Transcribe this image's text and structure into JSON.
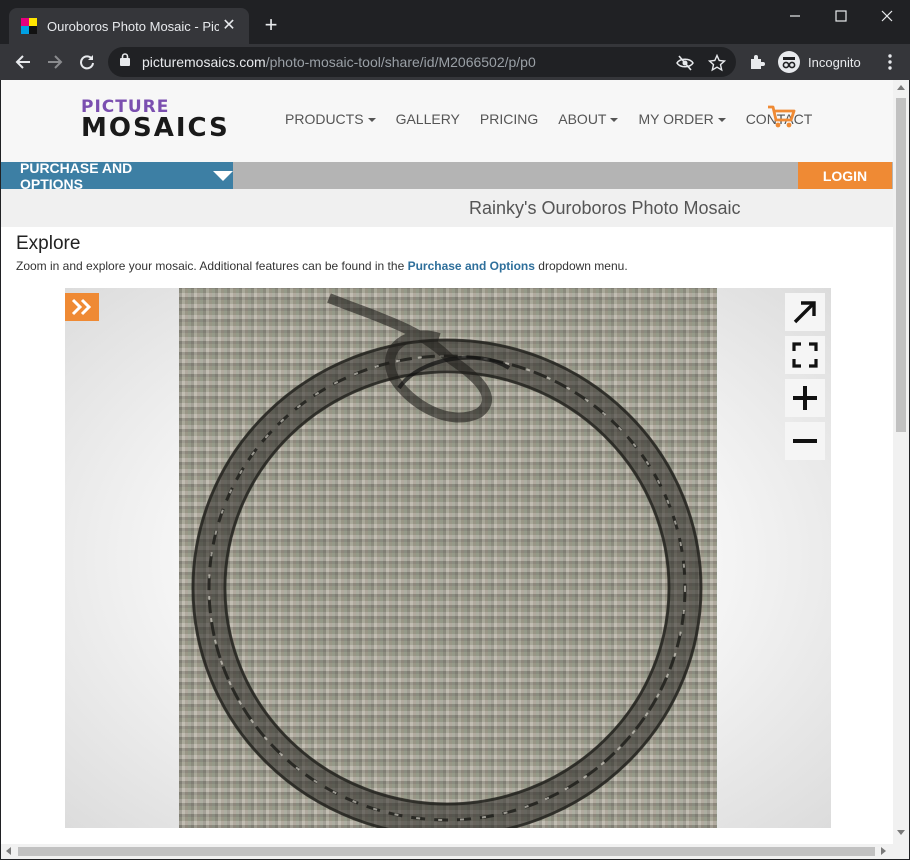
{
  "browser": {
    "tab_title": "Ouroboros Photo Mosaic - Picture Mosaics",
    "url_host": "picturemosaics.com",
    "url_path": "/photo-mosaic-tool/share/id/M2066502/p/p0",
    "incognito_label": "Incognito"
  },
  "site": {
    "logo_top": "PICTURE",
    "logo_bottom": "MOSAICS",
    "nav": [
      {
        "label": "PRODUCTS",
        "dropdown": true
      },
      {
        "label": "GALLERY",
        "dropdown": false
      },
      {
        "label": "PRICING",
        "dropdown": false
      },
      {
        "label": "ABOUT",
        "dropdown": true
      },
      {
        "label": "MY ORDER",
        "dropdown": true
      },
      {
        "label": "CONTACT",
        "dropdown": false
      }
    ],
    "purchase_label": "PURCHASE AND OPTIONS",
    "login_label": "LOGIN",
    "mosaic_title": "Rainky's Ouroboros Photo Mosaic",
    "explore_heading": "Explore",
    "explore_text_before": "Zoom in and explore your mosaic. Additional features can be found in the ",
    "explore_link": "Purchase and Options",
    "explore_text_after": " dropdown menu."
  },
  "colors": {
    "accent_orange": "#ef8a34",
    "purchase_blue": "#3d7fa4",
    "link_blue": "#2e6f9b"
  }
}
